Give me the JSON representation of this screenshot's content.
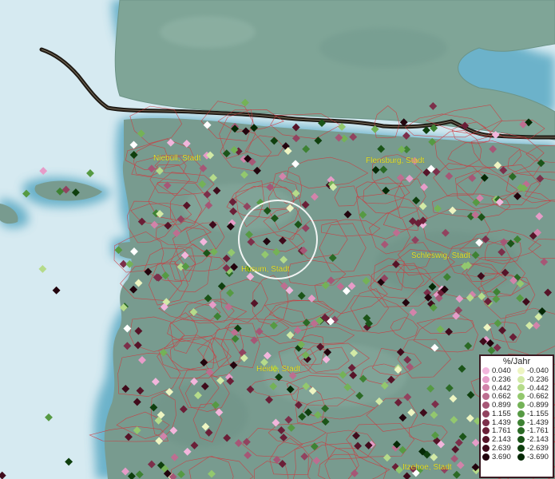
{
  "map": {
    "cities": [
      {
        "name": "Niebüll, Stadt"
      },
      {
        "name": "Flensburg, Stadt"
      },
      {
        "name": "Schleswig, Stadt"
      },
      {
        "name": "Husum, Stadt"
      },
      {
        "name": "Heide, Stadt"
      },
      {
        "name": "Itzehoe, Stadt"
      }
    ]
  },
  "legend": {
    "title": "%/Jahr",
    "positive": [
      {
        "value": "0.040",
        "color": "#f2b6dc"
      },
      {
        "value": "0.236",
        "color": "#e69cc8"
      },
      {
        "value": "0.442",
        "color": "#d283aa"
      },
      {
        "value": "0.662",
        "color": "#bd6e90"
      },
      {
        "value": "0.899",
        "color": "#a65776"
      },
      {
        "value": "1.155",
        "color": "#91435f"
      },
      {
        "value": "1.439",
        "color": "#7c2f4a"
      },
      {
        "value": "1.761",
        "color": "#6a1f37"
      },
      {
        "value": "2.143",
        "color": "#561428"
      },
      {
        "value": "2.639",
        "color": "#3f0b1b"
      },
      {
        "value": "3.690",
        "color": "#22040d"
      }
    ],
    "negative": [
      {
        "value": "-0.040",
        "color": "#eef5c2"
      },
      {
        "value": "-0.236",
        "color": "#d2eaa6"
      },
      {
        "value": "-0.442",
        "color": "#b5db8a"
      },
      {
        "value": "-0.662",
        "color": "#93c86e"
      },
      {
        "value": "-0.899",
        "color": "#74b257"
      },
      {
        "value": "-1.155",
        "color": "#569a43"
      },
      {
        "value": "-1.439",
        "color": "#3e8233"
      },
      {
        "value": "-1.761",
        "color": "#2b6a25"
      },
      {
        "value": "-2.143",
        "color": "#1b5418"
      },
      {
        "value": "-2.639",
        "color": "#0f3f0e"
      },
      {
        "value": "-3.690",
        "color": "#052905"
      }
    ]
  }
}
